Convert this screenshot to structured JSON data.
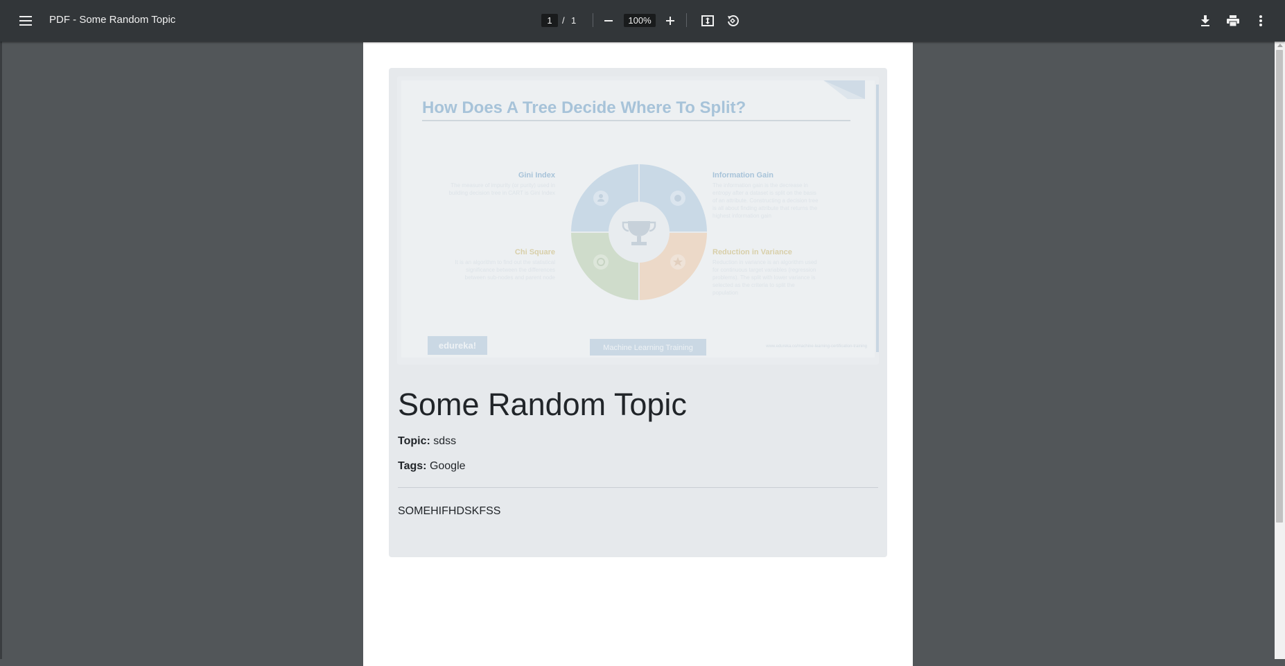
{
  "toolbar": {
    "title": "PDF - Some Random Topic",
    "current_page": "1",
    "page_separator": "/",
    "total_pages": "1",
    "zoom_level": "100%",
    "icons": [
      "menu-icon",
      "zoom-out-icon",
      "zoom-in-icon",
      "fit-to-page-icon",
      "rotate-icon",
      "download-icon",
      "print-icon",
      "more-options-icon"
    ]
  },
  "slide_image": {
    "title": "How Does A Tree Decide Where To Split?",
    "items": [
      {
        "heading": "Gini Index",
        "text_lines": [
          "The measure of impurity (or purity) used in",
          "building decision tree in CART is Gini Index"
        ]
      },
      {
        "heading": "Information Gain",
        "text_lines": [
          "The information gain is the decrease in",
          "entropy after a dataset is split on the basis",
          "of an attribute. Constructing a decision tree",
          "is all about finding attribute that returns the",
          "highest information gain"
        ]
      },
      {
        "heading": "Chi Square",
        "text_lines": [
          "It is an algorithm to find out the statistical",
          "significance between the differences",
          "between sub-nodes and parent node"
        ]
      },
      {
        "heading": "Reduction in Variance",
        "text_lines": [
          "Reduction in variance is an algorithm used",
          "for continuous target variables (regression",
          "problems). The split with lower variance is",
          "selected as the criteria to split the",
          "population"
        ]
      }
    ],
    "brand": "edureka!",
    "footer_label": "Machine Learning Training",
    "footer_url": "www.edureka.co/machine-learning-certification-training",
    "colors": {
      "blue": "#c9d9e6",
      "green": "#cfdccb",
      "orange": "#ecd9c8",
      "title": "#a7c3d9",
      "heading_gold": "#d8cfa9"
    }
  },
  "document": {
    "heading": "Some Random Topic",
    "topic_label": "Topic:",
    "topic_value": "sdss",
    "tags_label": "Tags:",
    "tags_value": "Google",
    "body": "SOMEHIFHDSKFSS"
  }
}
